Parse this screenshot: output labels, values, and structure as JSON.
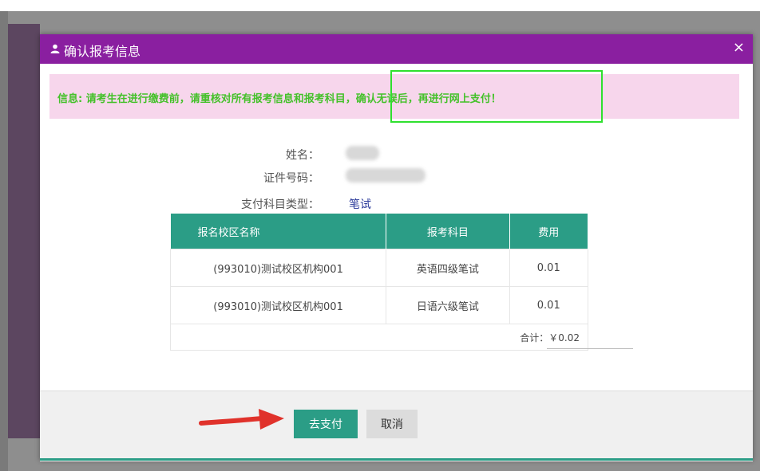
{
  "modal": {
    "title": "确认报考信息",
    "close_label": "×",
    "accent_color": "#8a1fa0"
  },
  "alert": {
    "text": "信息: 请考生在进行缴费前，请重核对所有报考信息和报考科目，确认无误后，再进行网上支付！",
    "background": "#f7d6ec",
    "text_color": "#44c12a"
  },
  "info": {
    "name_label": "姓名：",
    "id_label": "证件号码：",
    "type_label": "支付科目类型：",
    "type_value": "笔试"
  },
  "table": {
    "headers": [
      "报名校区名称",
      "报考科目",
      "费用"
    ],
    "rows": [
      [
        "(993010)测试校区机构001",
        "英语四级笔试",
        "0.01"
      ],
      [
        "(993010)测试校区机构001",
        "日语六级笔试",
        "0.01"
      ]
    ],
    "total": "合计：￥0.02",
    "header_color": "#2b9d86"
  },
  "footer": {
    "pay_label": "去支付",
    "cancel_label": "取消"
  }
}
